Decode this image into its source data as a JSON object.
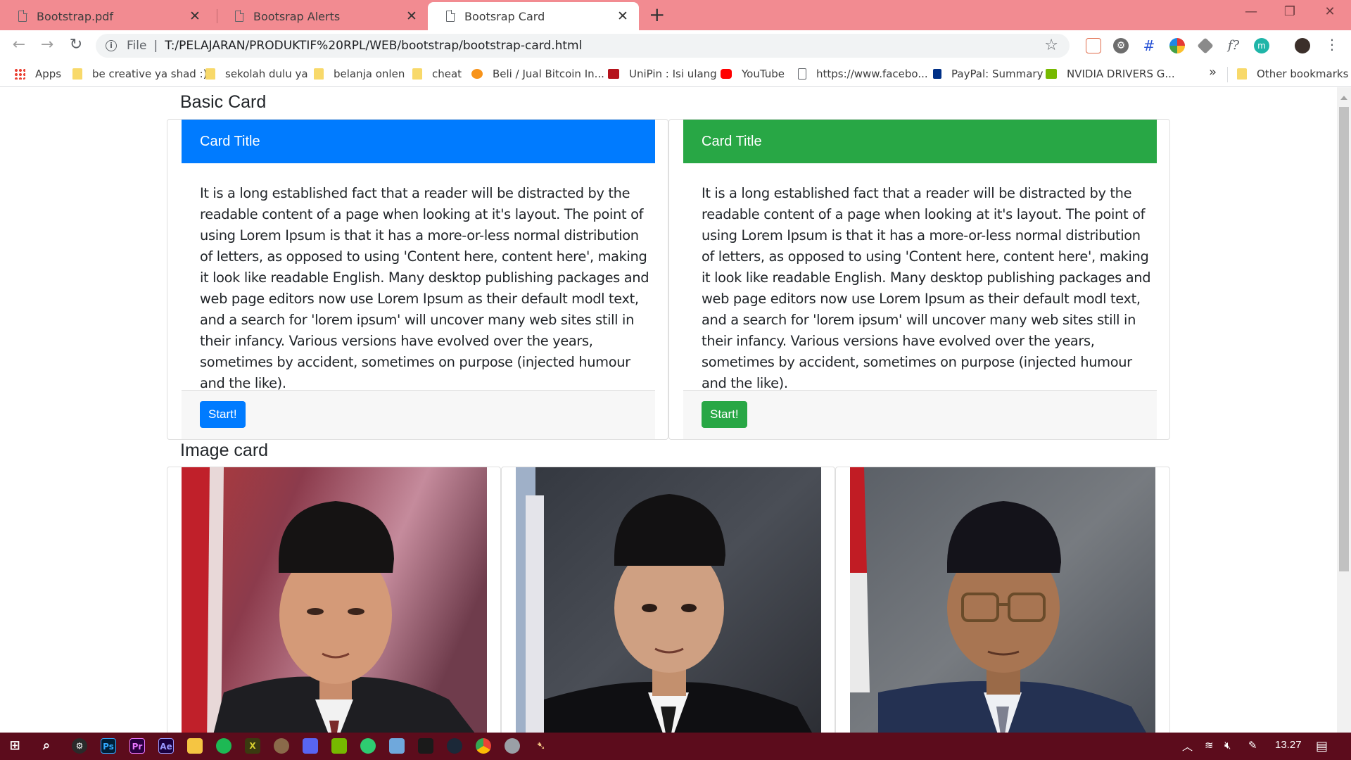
{
  "browser": {
    "tabs": [
      {
        "title": "Bootstrap.pdf",
        "active": false
      },
      {
        "title": "Bootsrap Alerts",
        "active": false
      },
      {
        "title": "Bootsrap Card",
        "active": true
      }
    ],
    "window_controls": {
      "minimize": "—",
      "restore": "❐",
      "close": "✕"
    },
    "address": {
      "scheme_label": "File",
      "url": "T:/PELAJARAN/PRODUKTIF%20RPL/WEB/bootstrap/bootstrap-card.html"
    },
    "bookmarks": [
      {
        "label": "Apps",
        "icon": "apps-grid-icon"
      },
      {
        "label": "be creative ya shad :)",
        "icon": "folder-icon"
      },
      {
        "label": "sekolah dulu ya",
        "icon": "folder-icon"
      },
      {
        "label": "belanja onlen",
        "icon": "folder-icon"
      },
      {
        "label": "cheat",
        "icon": "folder-icon"
      },
      {
        "label": "Beli / Jual Bitcoin In...",
        "icon": "bitcoin-icon"
      },
      {
        "label": "UniPin : Isi ulang",
        "icon": "unipin-icon"
      },
      {
        "label": "YouTube",
        "icon": "youtube-icon"
      },
      {
        "label": "https://www.facebo...",
        "icon": "page-icon"
      },
      {
        "label": "PayPal: Summary",
        "icon": "paypal-icon"
      },
      {
        "label": "NVIDIA DRIVERS G...",
        "icon": "nvidia-icon"
      }
    ],
    "bookmarks_overflow": "»",
    "other_bookmarks": "Other bookmarks"
  },
  "page": {
    "basic_heading": "Basic Card",
    "image_heading": "Image card",
    "basic_cards": [
      {
        "title": "Card Title",
        "header_color": "#007bff",
        "body": "It is a long established fact that a reader will be distracted by the readable content of a page when looking at it's layout. The point of using Lorem Ipsum is that it has a more-or-less normal distribution of letters, as opposed to using 'Content here, content here', making it look like readable English. Many desktop publishing packages and web page editors now use Lorem Ipsum as their default modl text, and a search for 'lorem ipsum' will uncover many web sites still in their infancy. Various versions have evolved over the years, sometimes by accident, sometimes on purpose (injected humour and the like).",
        "button": "Start!",
        "button_color": "#007bff"
      },
      {
        "title": "Card Title",
        "header_color": "#28a745",
        "body": "It is a long established fact that a reader will be distracted by the readable content of a page when looking at it's layout. The point of using Lorem Ipsum is that it has a more-or-less normal distribution of letters, as opposed to using 'Content here, content here', making it look like readable English. Many desktop publishing packages and web page editors now use Lorem Ipsum as their default modl text, and a search for 'lorem ipsum' will uncover many web sites still in their infancy. Various versions have evolved over the years, sometimes by accident, sometimes on purpose (injected humour and the like).",
        "button": "Start!",
        "button_color": "#28a745"
      }
    ],
    "image_cards": [
      {
        "icon": "portrait-photo"
      },
      {
        "icon": "portrait-photo"
      },
      {
        "icon": "portrait-photo"
      }
    ]
  },
  "taskbar": {
    "clock": "13.27",
    "accent": "#5c0c1c"
  }
}
